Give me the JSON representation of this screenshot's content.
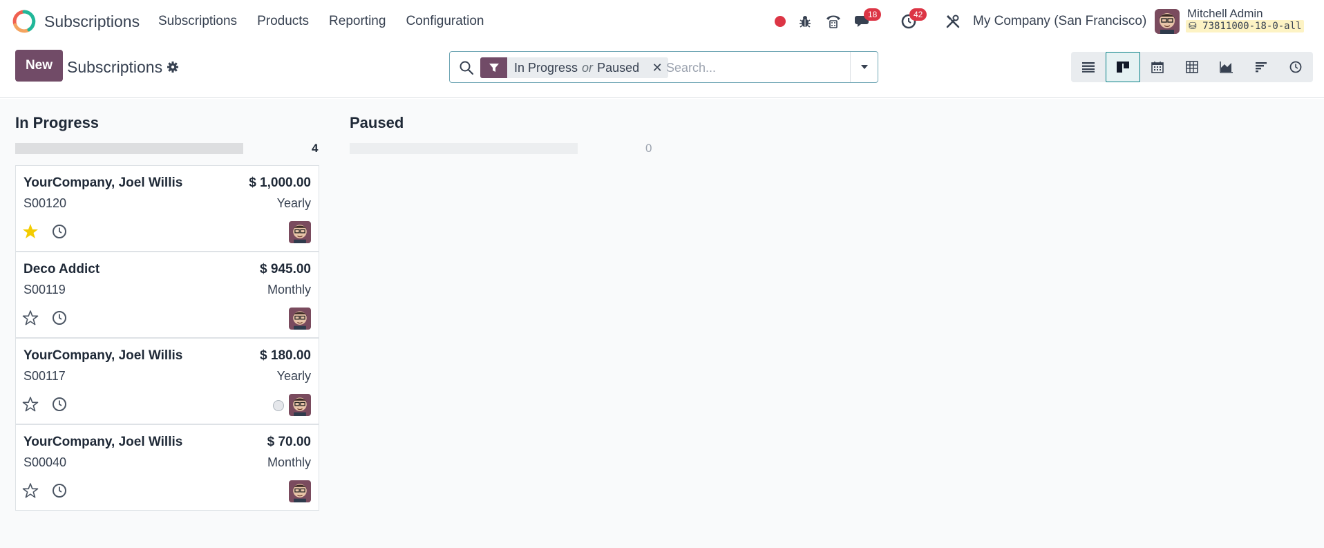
{
  "navbar": {
    "app_name": "Subscriptions",
    "menu": [
      "Subscriptions",
      "Products",
      "Reporting",
      "Configuration"
    ],
    "messages_count": "18",
    "activities_count": "42",
    "company": "My Company (San Francisco)",
    "user_name": "Mitchell Admin",
    "database": "73811000-18-0-all",
    "icons": [
      "record-icon",
      "bug-icon",
      "phone-icon",
      "chat-icon",
      "clock-icon",
      "tools-icon"
    ],
    "record_color": "#dc3545"
  },
  "control_panel": {
    "new_label": "New",
    "title": "Subscriptions",
    "search": {
      "facet_values": [
        "In Progress",
        "Paused"
      ],
      "facet_separator": "or",
      "placeholder": "Search..."
    },
    "views": [
      "list",
      "kanban",
      "calendar",
      "pivot",
      "graph",
      "cohort",
      "activity"
    ],
    "active_view": "kanban"
  },
  "colors": {
    "brand": "#714b67",
    "accent": "#017e84",
    "favorite": "#f3cc00"
  },
  "columns": [
    {
      "title": "In Progress",
      "count": "4",
      "cards": [
        {
          "name": "YourCompany, Joel Willis",
          "amount": "$ 1,000.00",
          "reference": "S00120",
          "period": "Yearly",
          "favorite": true,
          "state_dot": false
        },
        {
          "name": "Deco Addict",
          "amount": "$ 945.00",
          "reference": "S00119",
          "period": "Monthly",
          "favorite": false,
          "state_dot": false
        },
        {
          "name": "YourCompany, Joel Willis",
          "amount": "$ 180.00",
          "reference": "S00117",
          "period": "Yearly",
          "favorite": false,
          "state_dot": true
        },
        {
          "name": "YourCompany, Joel Willis",
          "amount": "$ 70.00",
          "reference": "S00040",
          "period": "Monthly",
          "favorite": false,
          "state_dot": false
        }
      ]
    },
    {
      "title": "Paused",
      "count": "0",
      "cards": []
    }
  ]
}
